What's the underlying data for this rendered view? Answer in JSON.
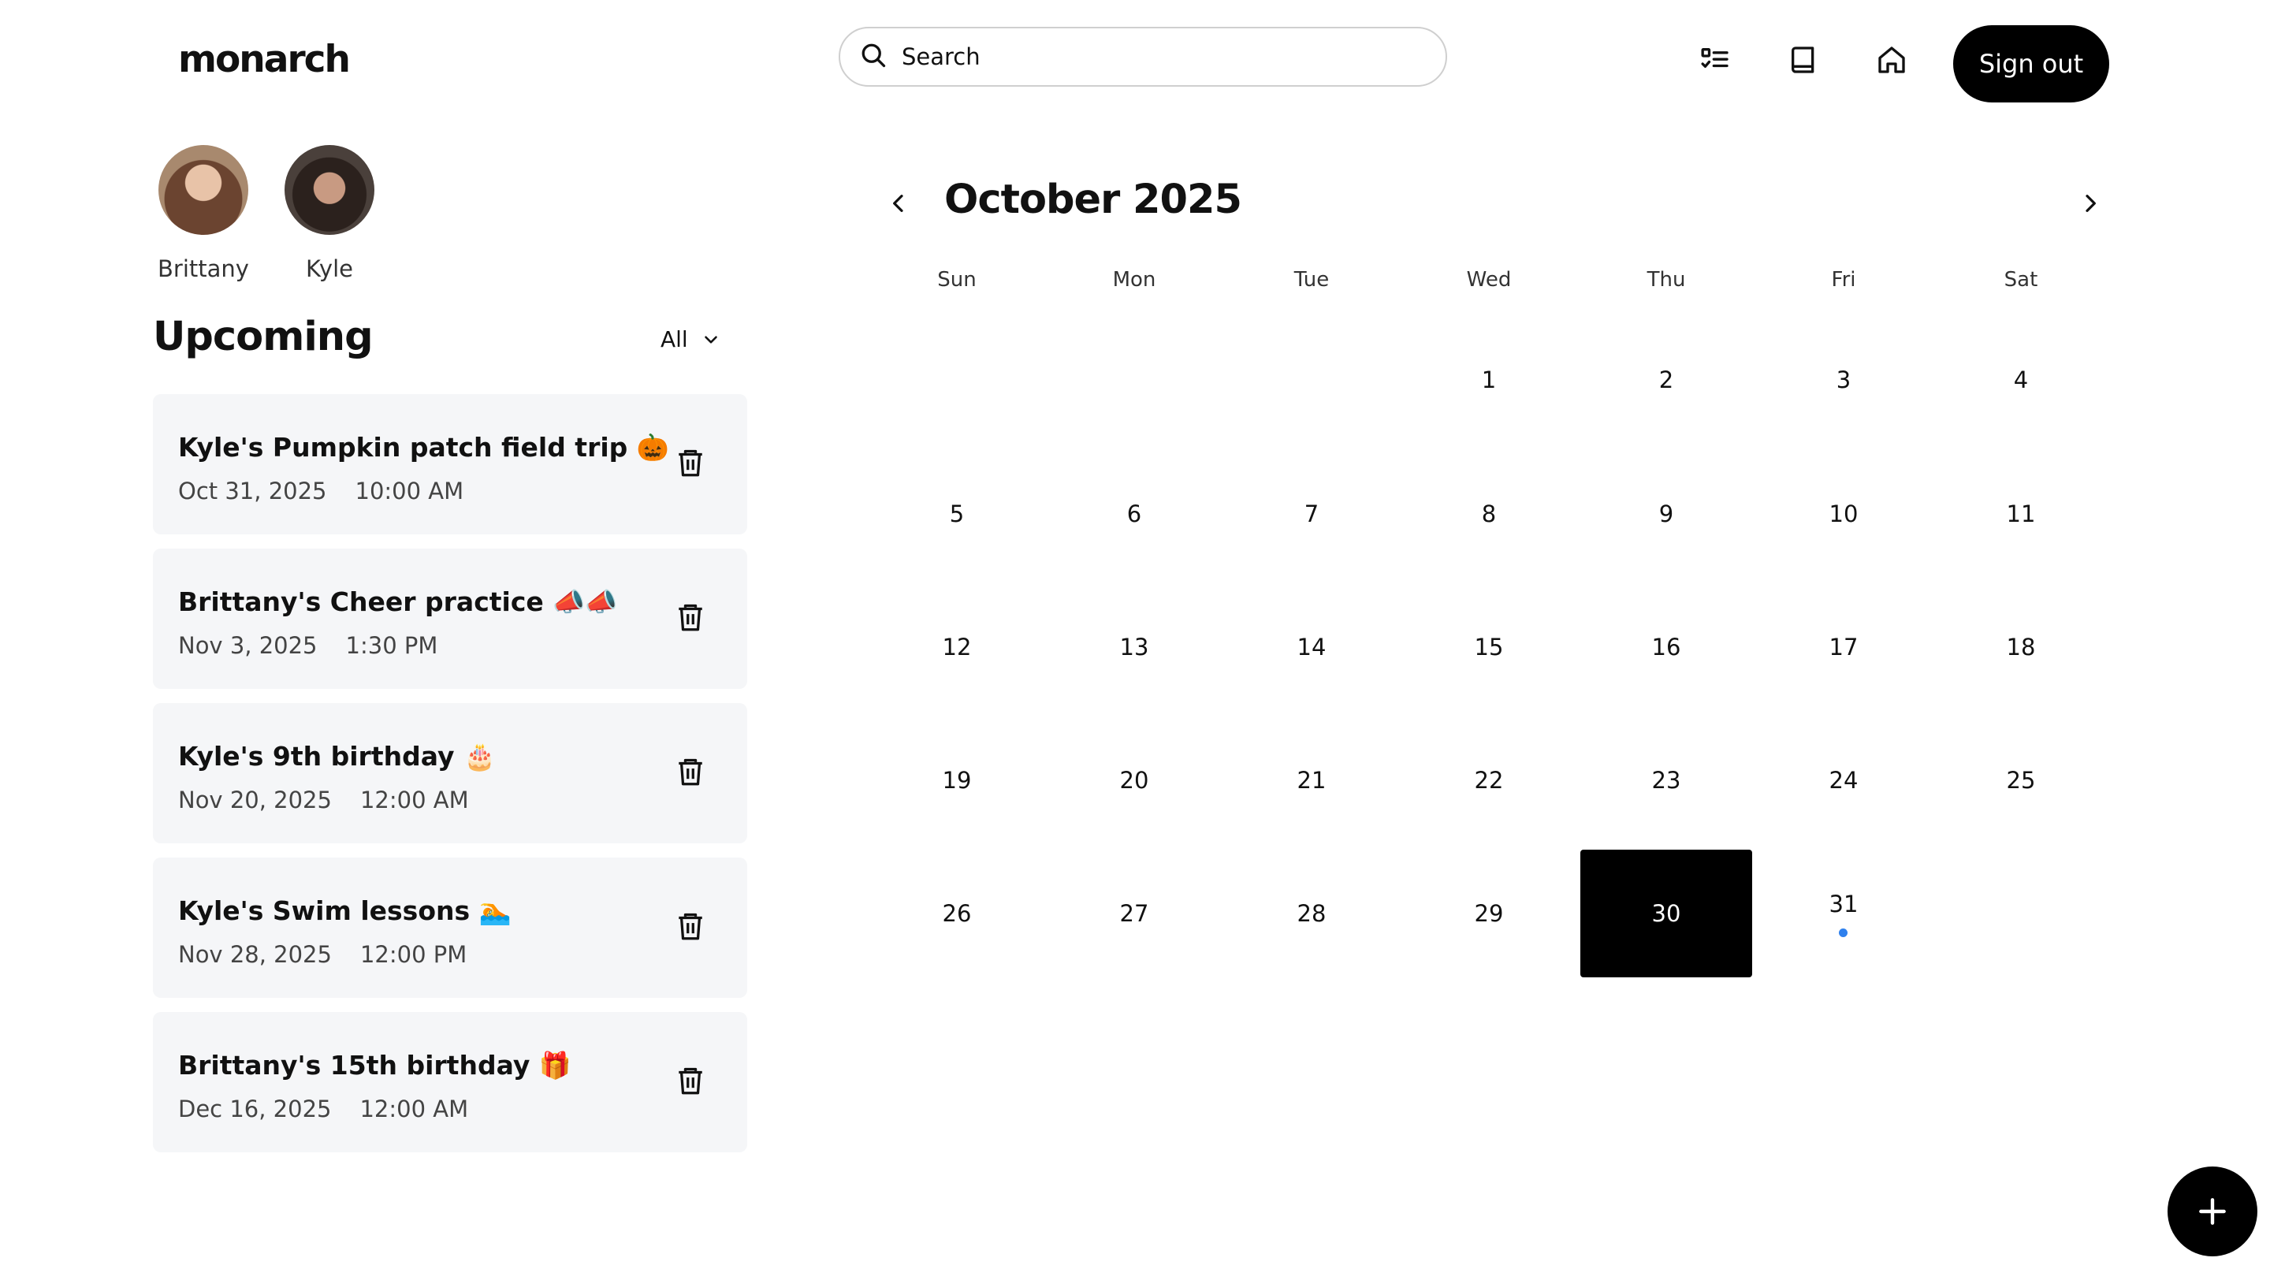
{
  "app": {
    "logo": "monarch"
  },
  "header": {
    "search_placeholder": "Search",
    "icons": [
      "checklist-icon",
      "book-icon",
      "home-icon"
    ],
    "signout_label": "Sign out"
  },
  "profiles": [
    {
      "name": "Brittany"
    },
    {
      "name": "Kyle"
    }
  ],
  "upcoming": {
    "title": "Upcoming",
    "filter": "All",
    "events": [
      {
        "title": "Kyle's Pumpkin patch field trip 🎃",
        "date": "Oct 31, 2025",
        "time": "10:00 AM"
      },
      {
        "title": "Brittany's Cheer practice 📣📣",
        "date": "Nov 3, 2025",
        "time": "1:30 PM"
      },
      {
        "title": "Kyle's 9th birthday 🎂",
        "date": "Nov 20, 2025",
        "time": "12:00 AM"
      },
      {
        "title": "Kyle's Swim lessons 🏊",
        "date": "Nov 28, 2025",
        "time": "12:00 PM"
      },
      {
        "title": "Brittany's 15th birthday 🎁",
        "date": "Dec 16, 2025",
        "time": "12:00 AM"
      }
    ]
  },
  "calendar": {
    "title": "October 2025",
    "weekdays": [
      "Sun",
      "Mon",
      "Tue",
      "Wed",
      "Thu",
      "Fri",
      "Sat"
    ],
    "first_weekday_index": 3,
    "days_in_month": 31,
    "selected_day": 30,
    "event_dot_days": [
      31
    ],
    "dot_color": "#2f80ed"
  },
  "colors": {
    "accent": "#000000",
    "card_bg": "#f5f6f8"
  }
}
